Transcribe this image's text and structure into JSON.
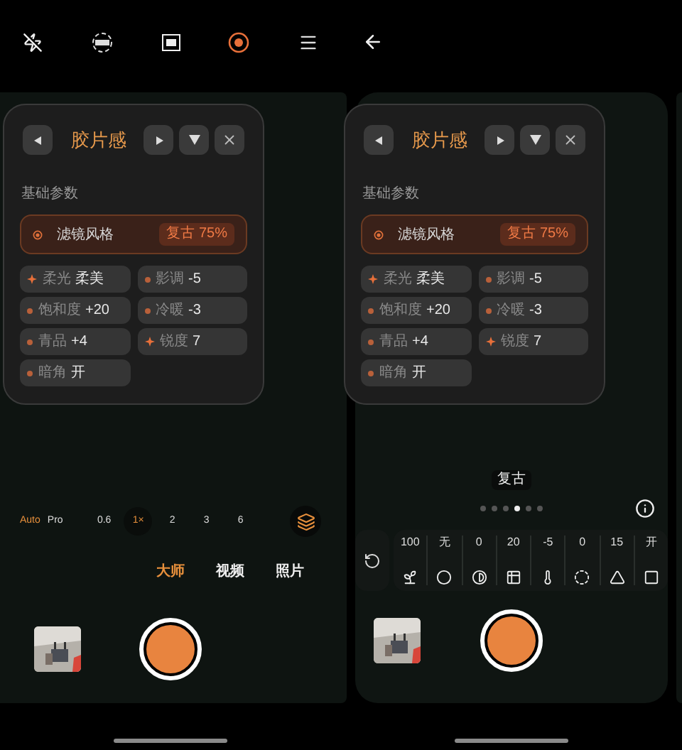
{
  "screens": [
    {
      "kind": "camera",
      "panel": {
        "title": "胶片感",
        "section": "基础参数",
        "filter": {
          "label": "滤镜风格",
          "value": "复古 75%"
        },
        "params": [
          {
            "kind": "star",
            "label": "柔光",
            "value": "柔美"
          },
          {
            "kind": "dot",
            "label": "影调",
            "value": "-5"
          },
          {
            "kind": "dot",
            "label": "饱和度",
            "value": "+20"
          },
          {
            "kind": "dot",
            "label": "冷暖",
            "value": "-3"
          },
          {
            "kind": "dot",
            "label": "青品",
            "value": "+4"
          },
          {
            "kind": "star",
            "label": "锐度",
            "value": "7"
          },
          {
            "kind": "dot",
            "label": "暗角",
            "value": "开"
          }
        ]
      },
      "camera_modes": [
        {
          "label": "Auto",
          "selected": true
        },
        {
          "label": "Pro",
          "selected": false
        }
      ],
      "zoom_levels": [
        {
          "label": "0.6",
          "selected": false
        },
        {
          "label": "1×",
          "selected": true
        },
        {
          "label": "2",
          "selected": false
        },
        {
          "label": "3",
          "selected": false
        },
        {
          "label": "6",
          "selected": false
        }
      ],
      "capture_modes": [
        {
          "label": "大师",
          "selected": true
        },
        {
          "label": "视频",
          "selected": false
        },
        {
          "label": "照片",
          "selected": false
        }
      ]
    },
    {
      "kind": "editor",
      "panel": {
        "title": "胶片感",
        "section": "基础参数",
        "filter": {
          "label": "滤镜风格",
          "value": "复古 75%"
        },
        "params": [
          {
            "kind": "star",
            "label": "柔光",
            "value": "柔美"
          },
          {
            "kind": "dot",
            "label": "影调",
            "value": "-5"
          },
          {
            "kind": "dot",
            "label": "饱和度",
            "value": "+20"
          },
          {
            "kind": "dot",
            "label": "冷暖",
            "value": "-3"
          },
          {
            "kind": "dot",
            "label": "青品",
            "value": "+4"
          },
          {
            "kind": "star",
            "label": "锐度",
            "value": "7"
          },
          {
            "kind": "dot",
            "label": "暗角",
            "value": "开"
          }
        ]
      },
      "filter_name": "复古",
      "page_dots": [
        {
          "selected": false
        },
        {
          "selected": false
        },
        {
          "selected": false
        },
        {
          "selected": true
        },
        {
          "selected": false
        },
        {
          "selected": false
        }
      ],
      "adjustments": [
        "100",
        "无",
        "0",
        "20",
        "-5",
        "0",
        "15",
        "开"
      ]
    }
  ]
}
